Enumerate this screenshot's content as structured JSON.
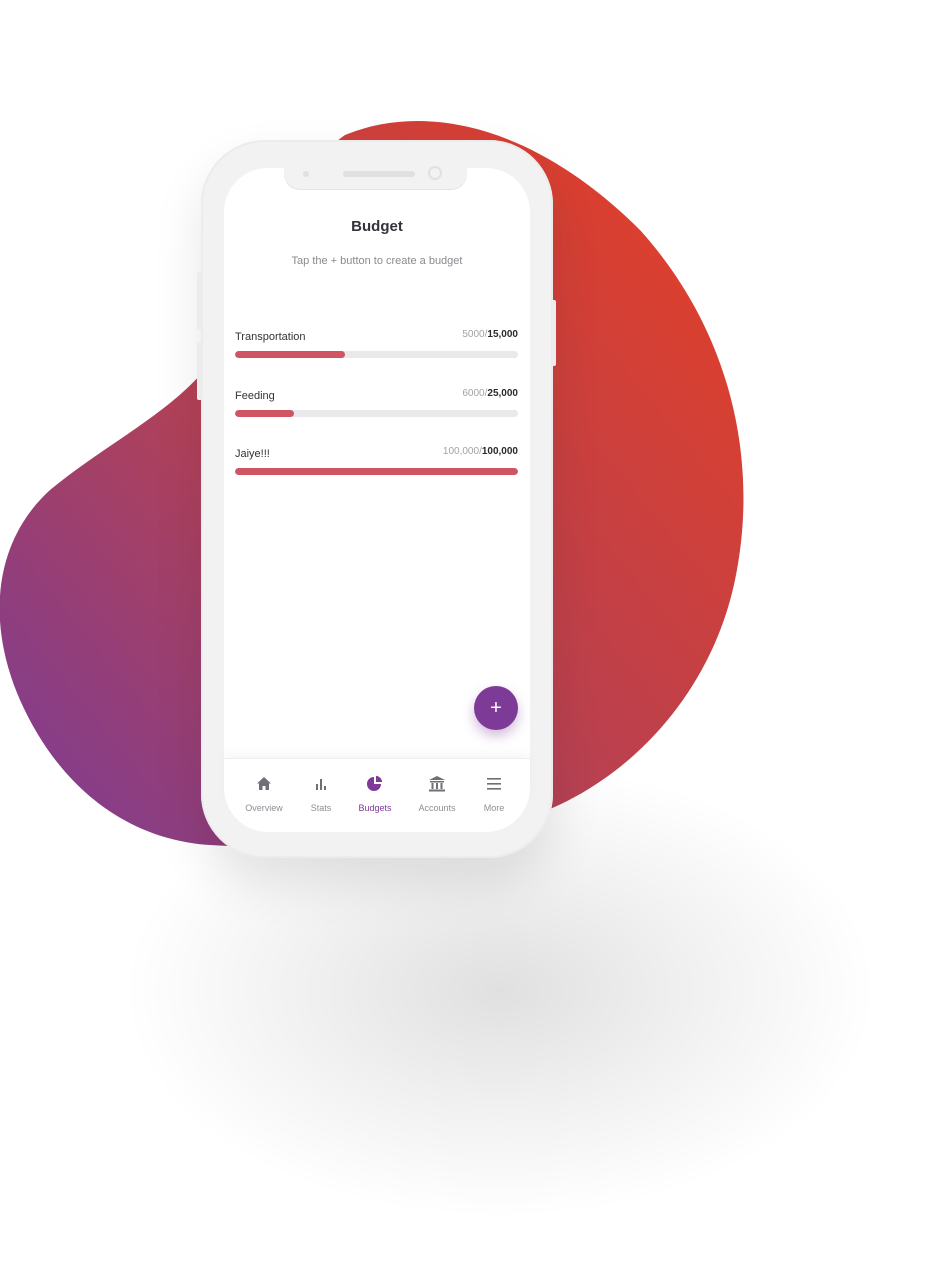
{
  "screen": {
    "title": "Budget",
    "subtitle": "Tap the + button to create a budget"
  },
  "budgets": [
    {
      "name": "Transportation",
      "spent": "5000",
      "total": "15,000",
      "progress": 0.39
    },
    {
      "name": "Feeding",
      "spent": "6000",
      "total": "25,000",
      "progress": 0.21
    },
    {
      "name": "Jaiye!!!",
      "spent": "100,000",
      "total": "100,000",
      "progress": 1.0
    }
  ],
  "fab": {
    "label": "+"
  },
  "tabbar": {
    "items": [
      {
        "label": "Overview",
        "icon": "home-icon",
        "active": false
      },
      {
        "label": "Stats",
        "icon": "bar-chart-icon",
        "active": false
      },
      {
        "label": "Budgets",
        "icon": "pie-chart-icon",
        "active": true
      },
      {
        "label": "Accounts",
        "icon": "bank-icon",
        "active": false
      },
      {
        "label": "More",
        "icon": "menu-icon",
        "active": false
      }
    ]
  },
  "colors": {
    "accent": "#7d3a97",
    "progress": "#cf5565",
    "blob_start": "#8a3f93",
    "blob_end": "#d9412f"
  }
}
